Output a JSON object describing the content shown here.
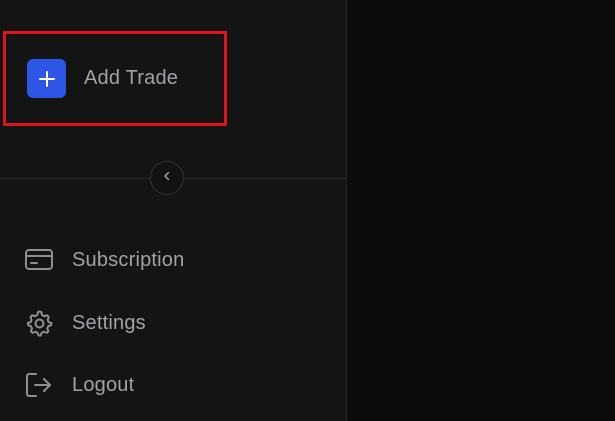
{
  "sidebar": {
    "add_trade": {
      "label": "Add Trade",
      "icon": "plus-icon"
    },
    "collapse": {
      "icon": "chevron-left-icon"
    },
    "items": [
      {
        "label": "Subscription",
        "icon": "credit-card-icon"
      },
      {
        "label": "Settings",
        "icon": "gear-icon"
      },
      {
        "label": "Logout",
        "icon": "logout-icon"
      }
    ]
  },
  "colors": {
    "accent": "#2d55e6",
    "highlight_border": "#e0141d",
    "text_muted": "#a1a1a8",
    "sidebar_bg": "#141414",
    "main_bg": "#0b0b0b"
  }
}
